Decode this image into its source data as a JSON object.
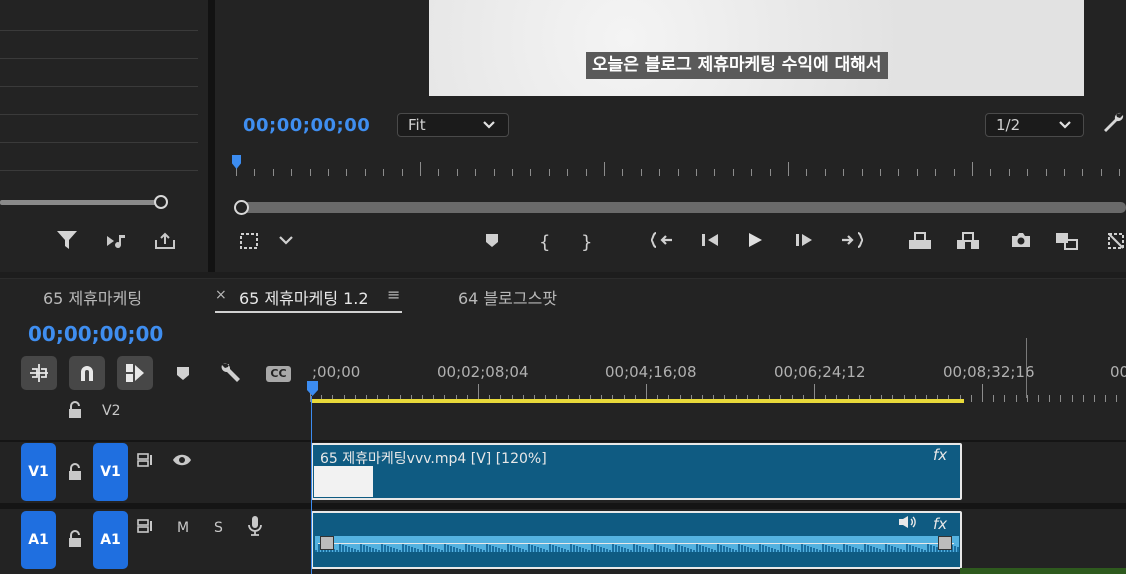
{
  "monitor": {
    "subtitle": "오늘은 블로그 제휴마케팅 수익에 대해서",
    "timecode": "00;00;00;00",
    "fit": "Fit",
    "resolution": "1/2"
  },
  "timeline": {
    "tabs": [
      {
        "label": "65 제휴마케팅"
      },
      {
        "label": "65 제휴마케팅 1.2",
        "active": true
      },
      {
        "label": "64 블로그스팟"
      }
    ],
    "close_glyph": "×",
    "menu_glyph": "≡",
    "timecode": "00;00;00;00",
    "cc_label": "CC",
    "ruler_labels": [
      ";00;00",
      "00;02;08;04",
      "00;04;16;08",
      "00;06;24;12",
      "00;08;32;16",
      "00"
    ],
    "tracks": {
      "v2": "V2",
      "v1_source": "V1",
      "v1_target": "V1",
      "a1_source": "A1",
      "a1_target": "A1",
      "mute": "M",
      "solo": "S"
    },
    "video_clip": {
      "name": "65 제휴마케팅vvv.mp4 [V] [120%]",
      "fx": "fx"
    },
    "audio_clip": {
      "fx": "fx"
    }
  },
  "icons": [
    "filter-icon",
    "music-note-icon",
    "export-icon",
    "wrench-icon",
    "marker-icon",
    "mark-in-icon",
    "mark-out-icon",
    "go-to-in-icon",
    "step-back-icon",
    "play-icon",
    "step-forward-icon",
    "go-to-out-icon",
    "lift-icon",
    "extract-icon",
    "camera-icon",
    "compare-icon",
    "magnet-icon",
    "lock-icon",
    "eye-icon",
    "microphone-icon"
  ],
  "colors": {
    "accent": "#3f8ef0",
    "track_blue": "#1f6fe0",
    "clip": "#0f5b82",
    "work_area": "#e8d93a"
  }
}
